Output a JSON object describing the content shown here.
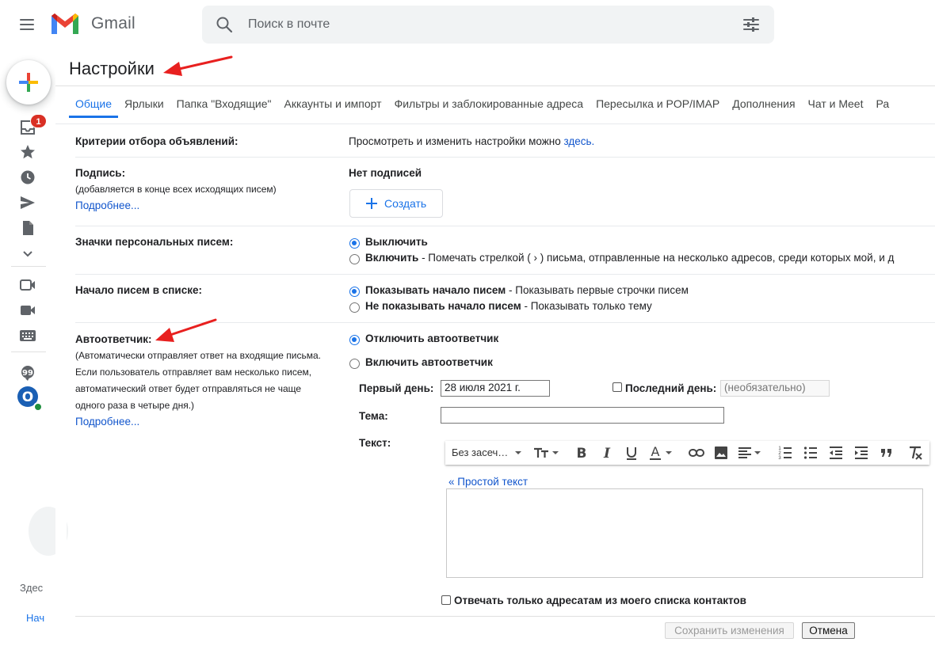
{
  "app": {
    "name": "Gmail"
  },
  "search": {
    "placeholder": "Поиск в почте"
  },
  "rail": {
    "inbox_badge": "1",
    "partial_text_1": "Здес",
    "partial_text_2": "Нач"
  },
  "page": {
    "title": "Настройки"
  },
  "tabs": [
    {
      "label": "Общие",
      "active": true
    },
    {
      "label": "Ярлыки"
    },
    {
      "label": "Папка \"Входящие\""
    },
    {
      "label": "Аккаунты и импорт"
    },
    {
      "label": "Фильтры и заблокированные адреса"
    },
    {
      "label": "Пересылка и POP/IMAP"
    },
    {
      "label": "Дополнения"
    },
    {
      "label": "Чат и Meet"
    },
    {
      "label": "Ра"
    }
  ],
  "settings": {
    "ads": {
      "label": "Критерии отбора объявлений:",
      "text": "Просмотреть и изменить настройки можно ",
      "link": "здесь."
    },
    "signature": {
      "label": "Подпись:",
      "sub": "(добавляется в конце всех исходящих писем)",
      "more": "Подробнее...",
      "status": "Нет подписей",
      "create": "Создать"
    },
    "personal_icons": {
      "label": "Значки персональных писем:",
      "opt_off": "Выключить",
      "opt_on": "Включить",
      "opt_on_desc": " - Помечать стрелкой ( › ) письма, отправленные на несколько адресов, среди которых мой, и д"
    },
    "snippets": {
      "label": "Начало писем в списке:",
      "opt_show": "Показывать начало писем",
      "opt_show_desc": " - Показывать первые строчки писем",
      "opt_hide": "Не показывать начало писем",
      "opt_hide_desc": " - Показывать только тему"
    },
    "vacation": {
      "label": "Автоответчик:",
      "sub_1": "(Автоматически отправляет ответ на входящие письма.",
      "sub_2": "Если пользователь отправляет вам несколько писем,",
      "sub_3": "автоматический ответ будет отправляться не чаще",
      "sub_4": "одного раза в четыре дня.)",
      "more": "Подробнее...",
      "opt_off": "Отключить автоответчик",
      "opt_on": "Включить автоответчик",
      "first_day_label": "Первый день:",
      "first_day_value": "28 июля 2021 г.",
      "last_day_label": "Последний день:",
      "last_day_placeholder": "(необязательно)",
      "subject_label": "Тема:",
      "text_label": "Текст:",
      "font": "Без засеч…",
      "plain_text_link": "« Простой текст",
      "contacts_only": "Отвечать только адресатам из моего списка контактов"
    }
  },
  "footer": {
    "save": "Сохранить изменения",
    "cancel": "Отмена"
  },
  "colors": {
    "accent": "#1a73e8",
    "link": "#1155cc",
    "annotation_arrow": "#e8201f",
    "badge": "#d93025"
  }
}
